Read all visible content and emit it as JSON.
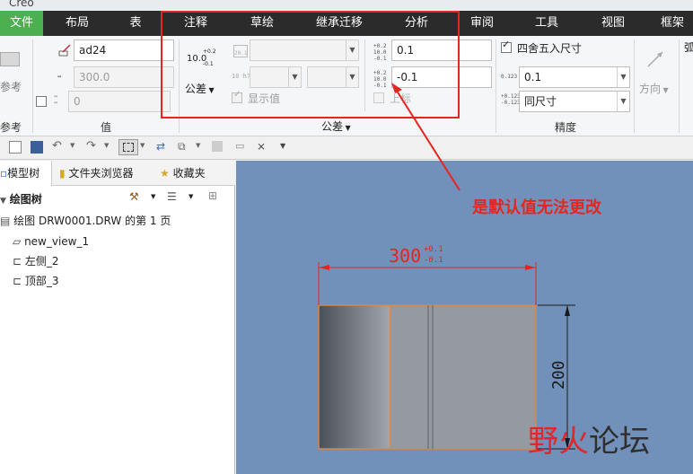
{
  "app": {
    "title": "Creo"
  },
  "menu": {
    "items": [
      "文件",
      "布局",
      "表",
      "注释",
      "草绘",
      "继承迁移",
      "分析",
      "审阅",
      "工具",
      "视图",
      "框架"
    ]
  },
  "ribbon": {
    "ref_group_label": "参考",
    "ref_tool_label": "参考",
    "value_group": {
      "label": "值",
      "name_value": "ad24",
      "nominal_value": "300.0",
      "decimals_value": "0"
    },
    "tolerance_group": {
      "label": "公差",
      "tolerance_button": "公差",
      "show_value_label": "显示值",
      "upper_value": "0.1",
      "lower_value": "-0.1",
      "upper_label": "上标",
      "icon_nominal": "10.0",
      "icon_plus": "+0.2",
      "icon_minus": "-0.1",
      "icon_h7": "10 h7",
      "icon_20_1": "20.1"
    },
    "precision_group": {
      "label": "精度",
      "rounding_label": "四舍五入尺寸",
      "rounding_checked": true,
      "precision_value": "0.1",
      "format_value": "同尺寸",
      "icon_0123": "0.123"
    },
    "direction_group": {
      "label": "方向",
      "truncated": "弧"
    }
  },
  "tree": {
    "tabs": [
      "模型树",
      "文件夹浏览器",
      "收藏夹"
    ],
    "header": "绘图树",
    "items": [
      {
        "label": "绘图 DRW0001.DRW 的第 1 页"
      },
      {
        "label": "new_view_1"
      },
      {
        "label": "左侧_2"
      },
      {
        "label": "顶部_3"
      }
    ]
  },
  "drawing": {
    "horizontal_dim": "300",
    "tol_upper": "+0.1",
    "tol_lower": "-0.1",
    "vertical_dim": "200"
  },
  "annotation": {
    "text": "是默认值无法更改",
    "color": "#e5251f"
  },
  "watermark": {
    "part1": "野火",
    "part2": "论坛"
  },
  "colors": {
    "canvas": "#7291ba",
    "accent_green": "#4caf50",
    "highlight_red": "#e5251f"
  }
}
